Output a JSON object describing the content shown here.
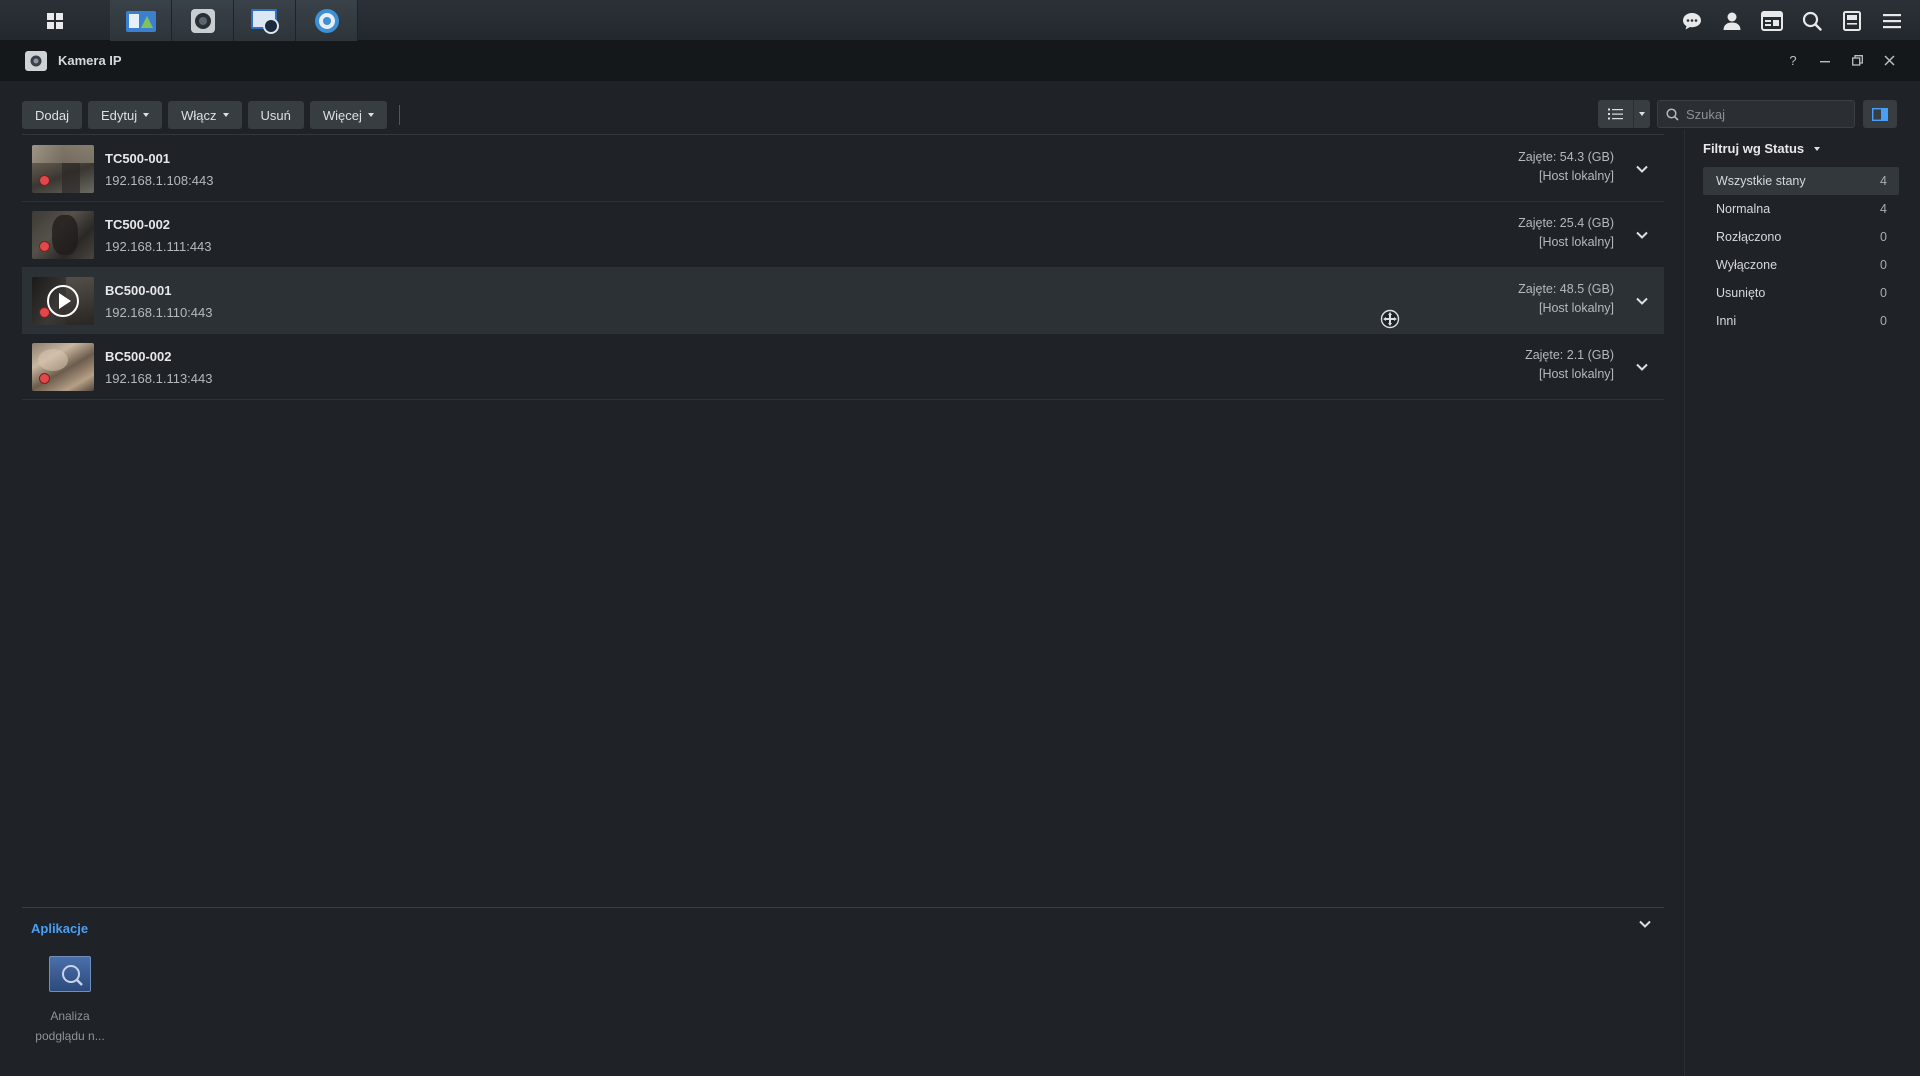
{
  "taskbar": {
    "left_icons": [
      "main-menu-icon",
      "file-station-icon",
      "surveillance-camera-icon",
      "recording-icon",
      "timeline-icon"
    ],
    "right_icons": [
      "chat-icon",
      "user-icon",
      "widgets-icon",
      "search-icon",
      "storage-icon",
      "options-icon"
    ]
  },
  "window": {
    "title": "Kamera IP",
    "controls": [
      "help-icon",
      "minimize-icon",
      "restore-icon",
      "close-icon"
    ]
  },
  "toolbar": {
    "add_label": "Dodaj",
    "edit_label": "Edytuj",
    "enable_label": "Włącz",
    "delete_label": "Usuń",
    "more_label": "Więcej"
  },
  "search": {
    "placeholder": "Szukaj"
  },
  "cameras": [
    {
      "name": "TC500-001",
      "ip": "192.168.1.108:443",
      "usage": "Zajęte: 54.3 (GB)",
      "host": "[Host lokalny]",
      "recording": true,
      "selected": false
    },
    {
      "name": "TC500-002",
      "ip": "192.168.1.111:443",
      "usage": "Zajęte: 25.4 (GB)",
      "host": "[Host lokalny]",
      "recording": true,
      "selected": false
    },
    {
      "name": "BC500-001",
      "ip": "192.168.1.110:443",
      "usage": "Zajęte: 48.5 (GB)",
      "host": "[Host lokalny]",
      "recording": true,
      "selected": true
    },
    {
      "name": "BC500-002",
      "ip": "192.168.1.113:443",
      "usage": "Zajęte: 2.1 (GB)",
      "host": "[Host lokalny]",
      "recording": true,
      "selected": false
    }
  ],
  "filter": {
    "title": "Filtruj wg Status",
    "items": [
      {
        "label": "Wszystkie stany",
        "count": "4",
        "active": true
      },
      {
        "label": "Normalna",
        "count": "4",
        "active": false
      },
      {
        "label": "Rozłączono",
        "count": "0",
        "active": false
      },
      {
        "label": "Wyłączone",
        "count": "0",
        "active": false
      },
      {
        "label": "Usunięto",
        "count": "0",
        "active": false
      },
      {
        "label": "Inni",
        "count": "0",
        "active": false
      }
    ]
  },
  "apps": {
    "title": "Aplikacje",
    "items": [
      {
        "label_line1": "Analiza",
        "label_line2": "podglądu n..."
      }
    ]
  },
  "colors": {
    "accent_blue": "#4a9ff5",
    "record_red": "#e0484a",
    "background": "#1f2226"
  }
}
